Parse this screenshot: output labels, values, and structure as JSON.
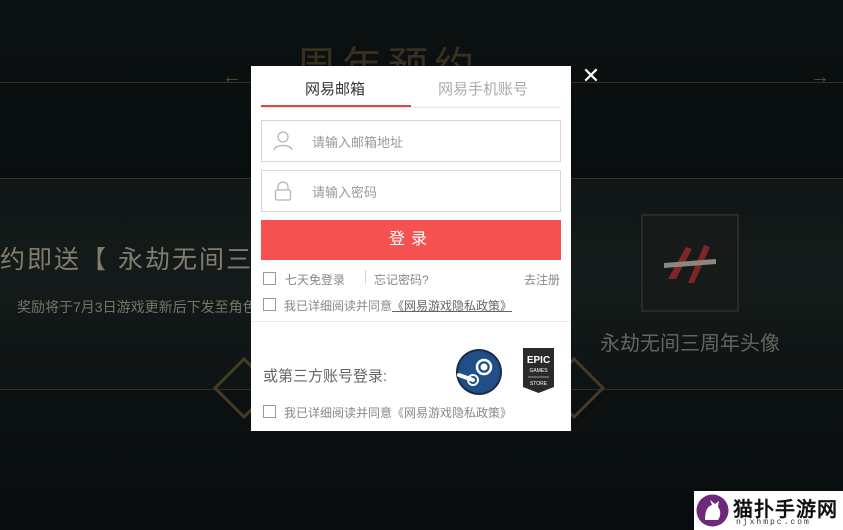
{
  "background": {
    "title": "周年预约",
    "gift_text": "约即送【 永劫无间三",
    "note_text": "奖励将于7月3日游戏更新后下发至角色",
    "avatar_caption": "永劫无间三周年头像"
  },
  "dialog": {
    "tabs": [
      {
        "label": "网易邮箱",
        "active": true
      },
      {
        "label": "网易手机账号",
        "active": false
      }
    ],
    "email_field": {
      "placeholder": "请输入邮箱地址",
      "value": ""
    },
    "password_field": {
      "placeholder": "请输入密码",
      "value": ""
    },
    "login_label": "登录",
    "remember_label": "七天免登录",
    "forgot_label": "忘记密码?",
    "register_label": "去注册",
    "agree_prefix": "我已详细阅读并同意",
    "agree_link": "《网易游戏隐私政策》",
    "third_party_label": "或第三方账号登录:",
    "third_party_agree": "我已详细阅读并同意《网易游戏隐私政策》",
    "close_icon": "close-icon",
    "accent_color": "#f55151",
    "providers": [
      {
        "name": "steam",
        "icon": "steam-icon"
      },
      {
        "name": "epic",
        "icon": "epic-games-icon",
        "logo_text": "EPIC",
        "sub_text": "GAMES",
        "store_text": "STORE"
      }
    ]
  },
  "watermark": {
    "title": "猫扑手游网",
    "url": "njxhmpc.com"
  }
}
